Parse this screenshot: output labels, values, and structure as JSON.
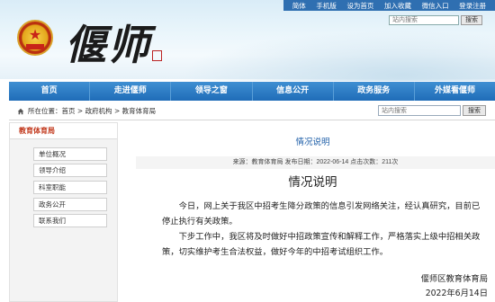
{
  "topbar": {
    "links": [
      "简体",
      "手机版",
      "设为首页",
      "加入收藏",
      "微信入口",
      "登录注册"
    ]
  },
  "header": {
    "logo_text": "偃师",
    "seal_text": "偃师",
    "search": {
      "placeholder": "站内搜索",
      "button": "搜索"
    }
  },
  "nav": {
    "items": [
      "首页",
      "走进偃师",
      "领导之窗",
      "信息公开",
      "政务服务",
      "外媒看偃师"
    ]
  },
  "breadcrumb": {
    "prefix": "所在位置：",
    "trail": [
      "首页",
      "政府机构",
      "教育体育局"
    ],
    "separator": " > ",
    "search": {
      "placeholder": "站内搜索",
      "button": "搜索"
    }
  },
  "sidebar": {
    "title": "教育体育局",
    "items": [
      "单位概况",
      "领导介绍",
      "科室职能",
      "政务公开",
      "联系我们"
    ]
  },
  "article": {
    "section_title": "情况说明",
    "meta": "来源：教育体育局 发布日期：2022-06-14 点击次数：211次",
    "title": "情况说明",
    "paragraphs": [
      "今日，网上关于我区中招考生降分政策的信息引发网络关注，经认真研究，目前已停止执行有关政策。",
      "下步工作中，我区将及时做好中招政策宣传和解释工作，严格落实上级中招相关政策，切实维护考生合法权益，做好今年的中招考试组织工作。"
    ],
    "signature": "偃师区教育体育局",
    "date": "2022年6月14日"
  },
  "colors": {
    "nav": "#1f6cb8",
    "topbar": "#2f6fb1",
    "section_title": "#1f5fa8",
    "sidebar_title": "#c23a1e"
  },
  "icons": [
    "emblem-icon",
    "home-icon"
  ]
}
